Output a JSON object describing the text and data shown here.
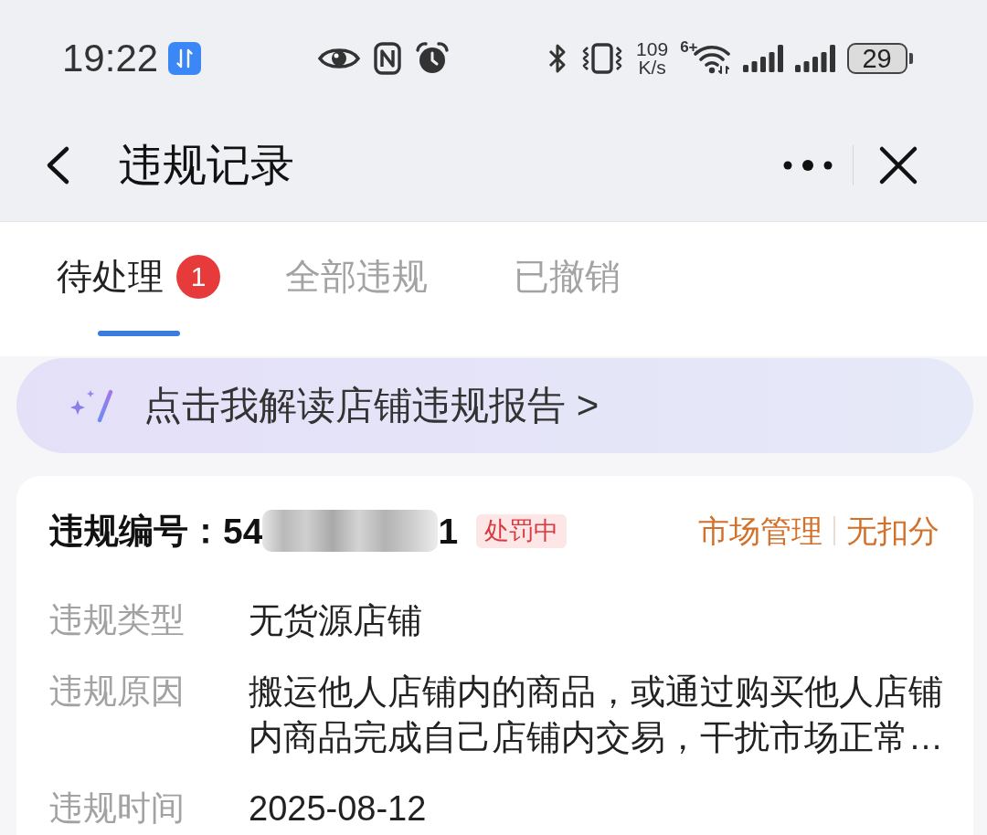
{
  "status_bar": {
    "time": "19:22",
    "network_speed": "109",
    "speed_unit": "K/s",
    "wifi_label": "6+",
    "battery": "29"
  },
  "header": {
    "title": "违规记录"
  },
  "tabs": [
    {
      "label": "待处理",
      "selected": true,
      "badge": "1"
    },
    {
      "label": "全部违规",
      "selected": false
    },
    {
      "label": "已撤销",
      "selected": false
    }
  ],
  "banner": {
    "text": "点击我解读店铺违规报告 >"
  },
  "record": {
    "number_label": "违规编号：",
    "number_start": "54",
    "number_end": "1",
    "status": "处罚中",
    "category": "市场管理",
    "deduction": "无扣分",
    "fields": [
      {
        "label": "违规类型",
        "value": "无货源店铺"
      },
      {
        "label": "违规原因",
        "value": "搬运他人店铺内的商品，或通过购买他人店铺内商品完成自己店铺内交易，干扰市场正常…"
      },
      {
        "label": "违规时间",
        "value": "2025-08-12"
      }
    ]
  }
}
